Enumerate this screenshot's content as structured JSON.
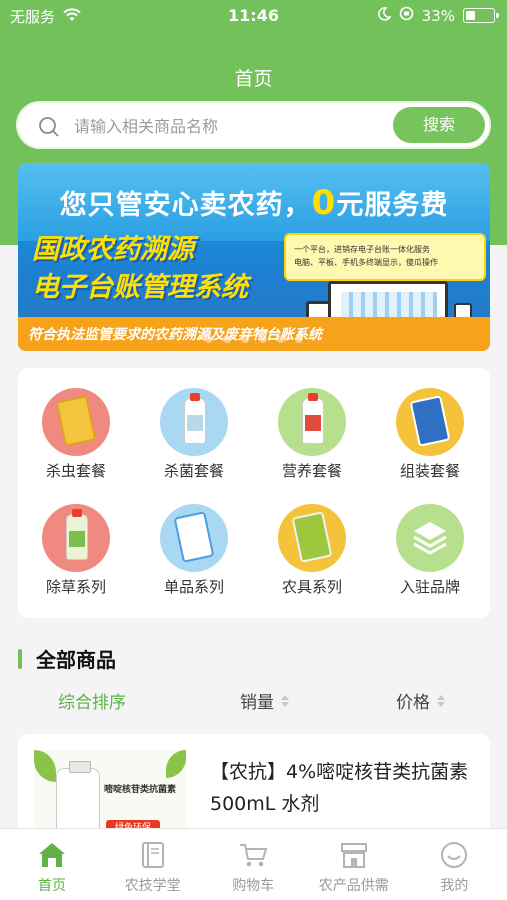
{
  "status_bar": {
    "carrier": "无服务",
    "time": "11:46",
    "battery": "33%",
    "battery_level": 0.33
  },
  "header": {
    "title": "首页"
  },
  "search": {
    "placeholder": "请输入相关商品名称",
    "button": "搜索"
  },
  "banner": {
    "headline_prefix": "您只管安心卖农药，",
    "headline_zero": "0",
    "headline_suffix": "元服务费",
    "title_line1": "国政农药溯源",
    "title_line2": "电子台账管理系统",
    "callout_line1": "一个平台，进销存电子台账一体化服务",
    "callout_line2": "电脑、平板、手机多终端显示，傻瓜操作",
    "footer": "符合执法监管要求的农药溯源及废弃物台账系统",
    "pages": 6
  },
  "categories": [
    {
      "label": "杀虫套餐",
      "icon": "insecticide-package-icon",
      "bg": "#f08a80"
    },
    {
      "label": "杀菌套餐",
      "icon": "fungicide-bottle-icon",
      "bg": "#a9d8f2"
    },
    {
      "label": "营养套餐",
      "icon": "nutrition-bottle-icon",
      "bg": "#b7e08e"
    },
    {
      "label": "组装套餐",
      "icon": "combo-package-icon",
      "bg": "#f5c33b"
    },
    {
      "label": "除草系列",
      "icon": "herbicide-bottle-icon",
      "bg": "#f08a80"
    },
    {
      "label": "单品系列",
      "icon": "single-product-icon",
      "bg": "#a9d8f2"
    },
    {
      "label": "农具系列",
      "icon": "farm-tool-icon",
      "bg": "#f5c33b"
    },
    {
      "label": "入驻品牌",
      "icon": "layers-icon",
      "bg": "#b7e08e"
    }
  ],
  "products_section": {
    "title": "全部商品",
    "sort": {
      "default": "综合排序",
      "sales": "销量",
      "price": "价格"
    }
  },
  "products": [
    {
      "name": "【农抗】4%嘧啶核苷类抗菌素 500mL 水剂",
      "image_text": "嘧啶核苷类抗菌素",
      "badge": "绿色环保"
    }
  ],
  "tabbar": [
    {
      "label": "首页",
      "icon": "home-icon",
      "active": true
    },
    {
      "label": "农技学堂",
      "icon": "book-icon",
      "active": false
    },
    {
      "label": "购物车",
      "icon": "cart-icon",
      "active": false
    },
    {
      "label": "农产品供需",
      "icon": "market-icon",
      "active": false
    },
    {
      "label": "我的",
      "icon": "profile-icon",
      "active": false
    }
  ],
  "colors": {
    "brand_green": "#73c15a",
    "active_green": "#5fb247",
    "banner_orange": "#f7a21b",
    "banner_yellow": "#ffe100"
  }
}
